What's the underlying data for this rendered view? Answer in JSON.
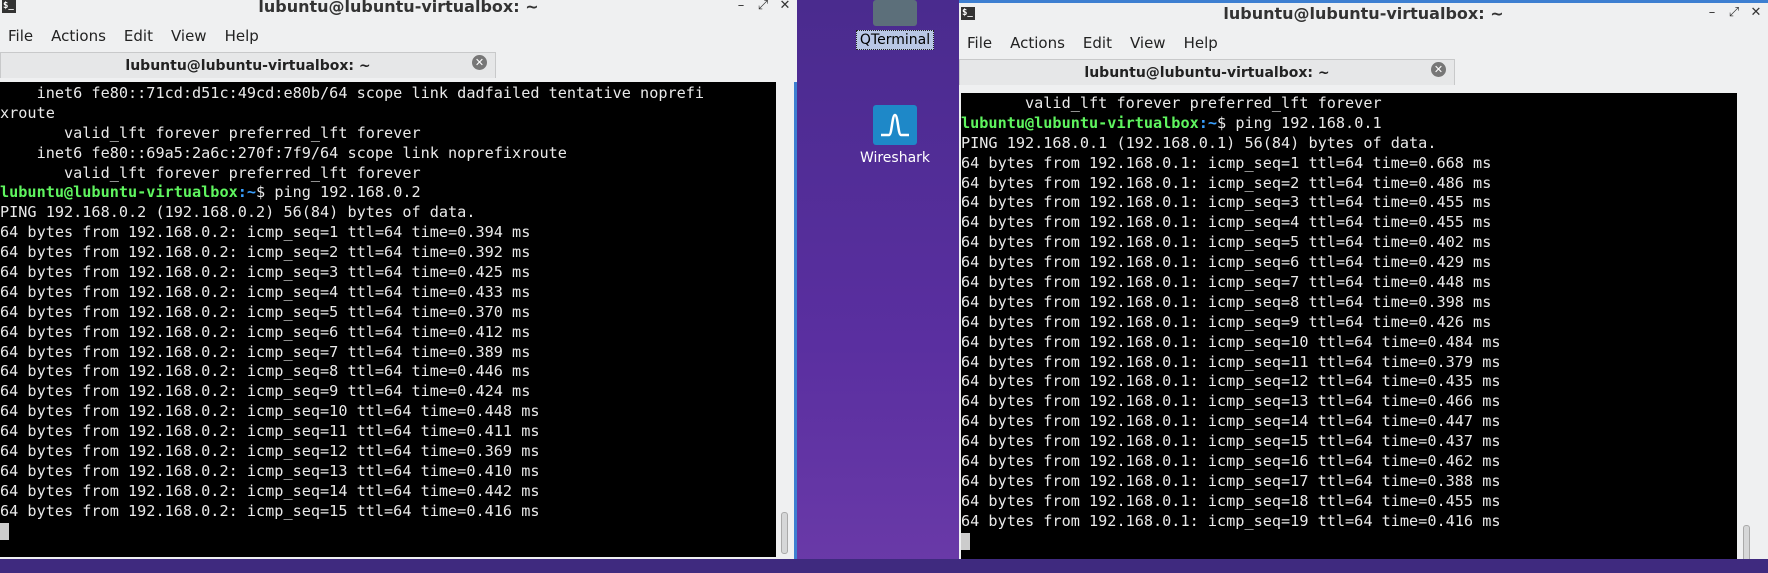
{
  "desktop": {
    "icons": [
      {
        "label": "QTerminal",
        "icon": "qterminal-icon"
      },
      {
        "label": "Wireshark",
        "icon": "wireshark-icon"
      }
    ]
  },
  "left_window": {
    "title": "lubuntu@lubuntu-virtualbox: ~",
    "title_icon_glyph": "$_",
    "menu": [
      "File",
      "Actions",
      "Edit",
      "View",
      "Help"
    ],
    "tab_label": "lubuntu@lubuntu-virtualbox: ~",
    "tab_close_glyph": "✕",
    "lines": [
      {
        "type": "text",
        "text": "    inet6 fe80::71cd:d51c:49cd:e80b/64 scope link dadfailed tentative noprefi"
      },
      {
        "type": "text",
        "text": "xroute"
      },
      {
        "type": "text",
        "text": "       valid_lft forever preferred_lft forever"
      },
      {
        "type": "text",
        "text": "    inet6 fe80::69a5:2a6c:270f:7f9/64 scope link noprefixroute"
      },
      {
        "type": "text",
        "text": "       valid_lft forever preferred_lft forever"
      },
      {
        "type": "prompt",
        "user": "lubuntu@lubuntu-virtualbox",
        "path": ":~",
        "cmd": "$ ping 192.168.0.2"
      },
      {
        "type": "text",
        "text": "PING 192.168.0.2 (192.168.0.2) 56(84) bytes of data."
      },
      {
        "type": "text",
        "text": "64 bytes from 192.168.0.2: icmp_seq=1 ttl=64 time=0.394 ms"
      },
      {
        "type": "text",
        "text": "64 bytes from 192.168.0.2: icmp_seq=2 ttl=64 time=0.392 ms"
      },
      {
        "type": "text",
        "text": "64 bytes from 192.168.0.2: icmp_seq=3 ttl=64 time=0.425 ms"
      },
      {
        "type": "text",
        "text": "64 bytes from 192.168.0.2: icmp_seq=4 ttl=64 time=0.433 ms"
      },
      {
        "type": "text",
        "text": "64 bytes from 192.168.0.2: icmp_seq=5 ttl=64 time=0.370 ms"
      },
      {
        "type": "text",
        "text": "64 bytes from 192.168.0.2: icmp_seq=6 ttl=64 time=0.412 ms"
      },
      {
        "type": "text",
        "text": "64 bytes from 192.168.0.2: icmp_seq=7 ttl=64 time=0.389 ms"
      },
      {
        "type": "text",
        "text": "64 bytes from 192.168.0.2: icmp_seq=8 ttl=64 time=0.446 ms"
      },
      {
        "type": "text",
        "text": "64 bytes from 192.168.0.2: icmp_seq=9 ttl=64 time=0.424 ms"
      },
      {
        "type": "text",
        "text": "64 bytes from 192.168.0.2: icmp_seq=10 ttl=64 time=0.448 ms"
      },
      {
        "type": "text",
        "text": "64 bytes from 192.168.0.2: icmp_seq=11 ttl=64 time=0.411 ms"
      },
      {
        "type": "text",
        "text": "64 bytes from 192.168.0.2: icmp_seq=12 ttl=64 time=0.369 ms"
      },
      {
        "type": "text",
        "text": "64 bytes from 192.168.0.2: icmp_seq=13 ttl=64 time=0.410 ms"
      },
      {
        "type": "text",
        "text": "64 bytes from 192.168.0.2: icmp_seq=14 ttl=64 time=0.442 ms"
      },
      {
        "type": "text",
        "text": "64 bytes from 192.168.0.2: icmp_seq=15 ttl=64 time=0.416 ms"
      },
      {
        "type": "cursor"
      }
    ]
  },
  "right_window": {
    "title": "lubuntu@lubuntu-virtualbox: ~",
    "title_icon_glyph": "$_",
    "menu": [
      "File",
      "Actions",
      "Edit",
      "View",
      "Help"
    ],
    "tab_label": "lubuntu@lubuntu-virtualbox: ~",
    "tab_close_glyph": "✕",
    "lines": [
      {
        "type": "text",
        "text": "       valid_lft forever preferred_lft forever"
      },
      {
        "type": "prompt",
        "user": "lubuntu@lubuntu-virtualbox",
        "path": ":~",
        "cmd": "$ ping 192.168.0.1"
      },
      {
        "type": "text",
        "text": "PING 192.168.0.1 (192.168.0.1) 56(84) bytes of data."
      },
      {
        "type": "text",
        "text": "64 bytes from 192.168.0.1: icmp_seq=1 ttl=64 time=0.668 ms"
      },
      {
        "type": "text",
        "text": "64 bytes from 192.168.0.1: icmp_seq=2 ttl=64 time=0.486 ms"
      },
      {
        "type": "text",
        "text": "64 bytes from 192.168.0.1: icmp_seq=3 ttl=64 time=0.455 ms"
      },
      {
        "type": "text",
        "text": "64 bytes from 192.168.0.1: icmp_seq=4 ttl=64 time=0.455 ms"
      },
      {
        "type": "text",
        "text": "64 bytes from 192.168.0.1: icmp_seq=5 ttl=64 time=0.402 ms"
      },
      {
        "type": "text",
        "text": "64 bytes from 192.168.0.1: icmp_seq=6 ttl=64 time=0.429 ms"
      },
      {
        "type": "text",
        "text": "64 bytes from 192.168.0.1: icmp_seq=7 ttl=64 time=0.448 ms"
      },
      {
        "type": "text",
        "text": "64 bytes from 192.168.0.1: icmp_seq=8 ttl=64 time=0.398 ms"
      },
      {
        "type": "text",
        "text": "64 bytes from 192.168.0.1: icmp_seq=9 ttl=64 time=0.426 ms"
      },
      {
        "type": "text",
        "text": "64 bytes from 192.168.0.1: icmp_seq=10 ttl=64 time=0.484 ms"
      },
      {
        "type": "text",
        "text": "64 bytes from 192.168.0.1: icmp_seq=11 ttl=64 time=0.379 ms"
      },
      {
        "type": "text",
        "text": "64 bytes from 192.168.0.1: icmp_seq=12 ttl=64 time=0.435 ms"
      },
      {
        "type": "text",
        "text": "64 bytes from 192.168.0.1: icmp_seq=13 ttl=64 time=0.466 ms"
      },
      {
        "type": "text",
        "text": "64 bytes from 192.168.0.1: icmp_seq=14 ttl=64 time=0.447 ms"
      },
      {
        "type": "text",
        "text": "64 bytes from 192.168.0.1: icmp_seq=15 ttl=64 time=0.437 ms"
      },
      {
        "type": "text",
        "text": "64 bytes from 192.168.0.1: icmp_seq=16 ttl=64 time=0.462 ms"
      },
      {
        "type": "text",
        "text": "64 bytes from 192.168.0.1: icmp_seq=17 ttl=64 time=0.388 ms"
      },
      {
        "type": "text",
        "text": "64 bytes from 192.168.0.1: icmp_seq=18 ttl=64 time=0.455 ms"
      },
      {
        "type": "text",
        "text": "64 bytes from 192.168.0.1: icmp_seq=19 ttl=64 time=0.416 ms"
      },
      {
        "type": "cursor"
      }
    ]
  },
  "colors": {
    "prompt_user": "#5ff55f",
    "prompt_path": "#3aa0ff",
    "terminal_bg": "#000000",
    "terminal_fg": "#eaeaea",
    "window_chrome": "#eff0f1",
    "active_border": "#3d7fd1"
  }
}
